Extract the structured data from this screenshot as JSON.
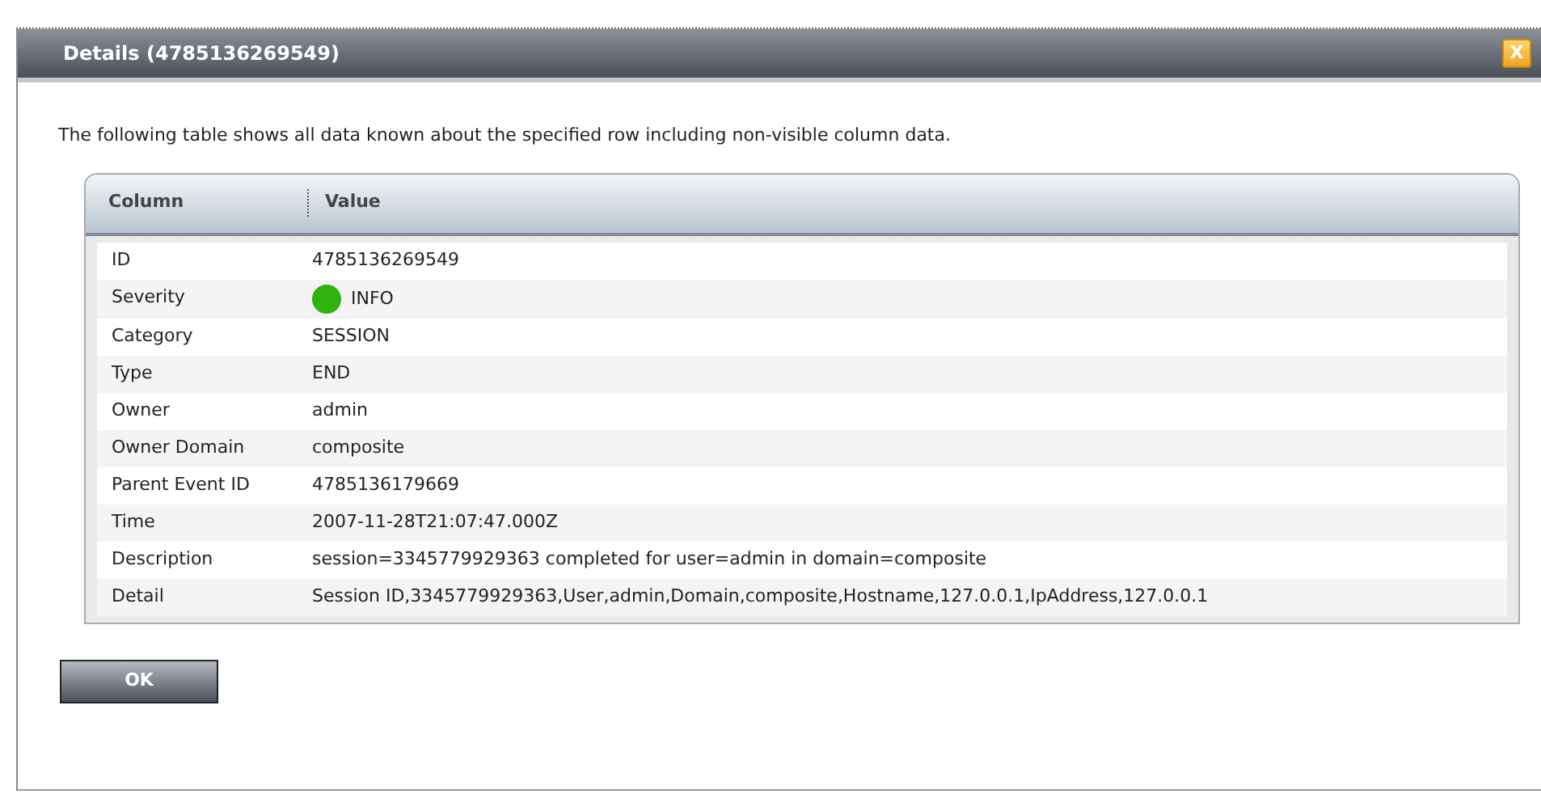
{
  "dialog": {
    "title": "Details (4785136269549)",
    "close_label": "X"
  },
  "intro": "The following table shows all data known about the specified row including non-visible column data.",
  "table": {
    "columns": [
      "Column",
      "Value"
    ],
    "rows": [
      {
        "kind": "text",
        "column": "ID",
        "value": "4785136269549"
      },
      {
        "kind": "status",
        "column": "Severity",
        "value": "INFO",
        "color": "#2fb30f"
      },
      {
        "kind": "text",
        "column": "Category",
        "value": "SESSION"
      },
      {
        "kind": "text",
        "column": "Type",
        "value": "END"
      },
      {
        "kind": "text",
        "column": "Owner",
        "value": "admin"
      },
      {
        "kind": "text",
        "column": "Owner Domain",
        "value": "composite"
      },
      {
        "kind": "text",
        "column": "Parent Event ID",
        "value": "4785136179669"
      },
      {
        "kind": "text",
        "column": "Time",
        "value": "2007-11-28T21:07:47.000Z"
      },
      {
        "kind": "text",
        "column": "Description",
        "value": "session=3345779929363 completed for user=admin in domain=composite"
      },
      {
        "kind": "text",
        "column": "Detail",
        "value": "Session ID,3345779929363,User,admin,Domain,composite,Hostname,127.0.0.1,IpAddress,127.0.0.1"
      }
    ]
  },
  "buttons": [
    "OK"
  ]
}
